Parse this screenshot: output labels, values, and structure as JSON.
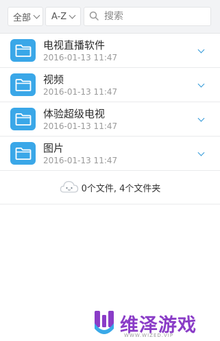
{
  "toolbar": {
    "filter_label": "全部",
    "sort_label": "A-Z",
    "search_placeholder": "搜索"
  },
  "folders": [
    {
      "name": "电视直播软件",
      "date": "2016-01-13 11:47"
    },
    {
      "name": "视频",
      "date": "2016-01-13 11:47"
    },
    {
      "name": "体验超级电视",
      "date": "2016-01-13 11:47"
    },
    {
      "name": "图片",
      "date": "2016-01-13 11:47"
    }
  ],
  "summary": {
    "text": "0个文件, 4个文件夹"
  },
  "watermark": {
    "text": "维泽游戏",
    "subtext": "WWW.WIZED.VIP"
  },
  "colors": {
    "accent": "#3aa7e8",
    "toolbar_bg": "#f2f3f5",
    "watermark": "#8a3cc7"
  }
}
